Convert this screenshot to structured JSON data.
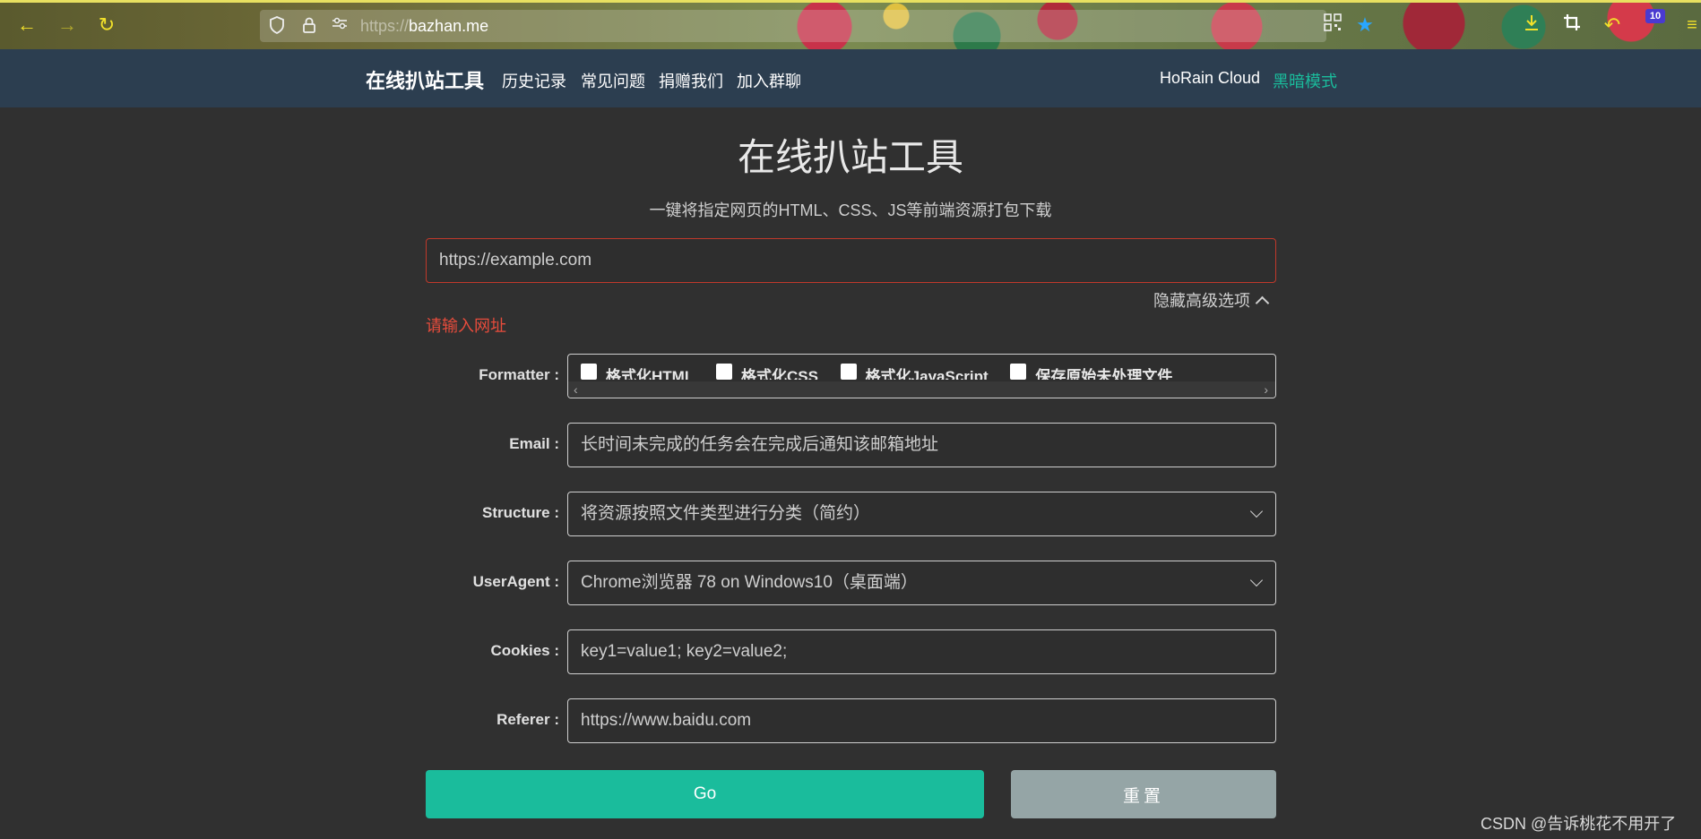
{
  "browser": {
    "url_protocol": "https://",
    "url_host": "bazhan.me",
    "extension_badge": "10",
    "icons": {
      "back": "arrow-left-icon",
      "forward": "arrow-right-icon",
      "reload": "reload-icon",
      "shield": "shield-icon",
      "lock": "lock-icon",
      "permissions": "permissions-icon",
      "qr": "qr-code-icon",
      "star": "star-icon",
      "download": "download-icon",
      "crop": "crop-icon",
      "undo": "undo-icon",
      "menu": "menu-icon"
    }
  },
  "header": {
    "brand": "在线扒站工具",
    "nav": [
      "历史记录",
      "常见问题",
      "捐赠我们",
      "加入群聊"
    ],
    "right_link": "HoRain Cloud",
    "dark_mode": "黑暗模式"
  },
  "main": {
    "title": "在线扒站工具",
    "subtitle": "一键将指定网页的HTML、CSS、JS等前端资源打包下载",
    "url_placeholder": "https://example.com",
    "advanced_toggle": "隐藏高级选项",
    "error": "请输入网址"
  },
  "form": {
    "formatter": {
      "label": "Formatter :",
      "options": [
        "格式化HTML",
        "格式化CSS",
        "格式化JavaScript",
        "保存原始未处理文件"
      ]
    },
    "email": {
      "label": "Email :",
      "placeholder": "长时间未完成的任务会在完成后通知该邮箱地址"
    },
    "structure": {
      "label": "Structure :",
      "value": "将资源按照文件类型进行分类（简约）"
    },
    "useragent": {
      "label": "UserAgent :",
      "value": "Chrome浏览器 78 on Windows10（桌面端）"
    },
    "cookies": {
      "label": "Cookies :",
      "placeholder": "key1=value1; key2=value2;"
    },
    "referer": {
      "label": "Referer :",
      "placeholder": "https://www.baidu.com"
    }
  },
  "buttons": {
    "go": "Go",
    "reset": "重置"
  },
  "watermark": "CSDN @告诉桃花不用开了",
  "colors": {
    "header_bg": "#2c3e50",
    "page_bg": "#303030",
    "accent": "#1abc9c",
    "error": "#e74c3c",
    "reset_btn": "#95a5a6"
  }
}
